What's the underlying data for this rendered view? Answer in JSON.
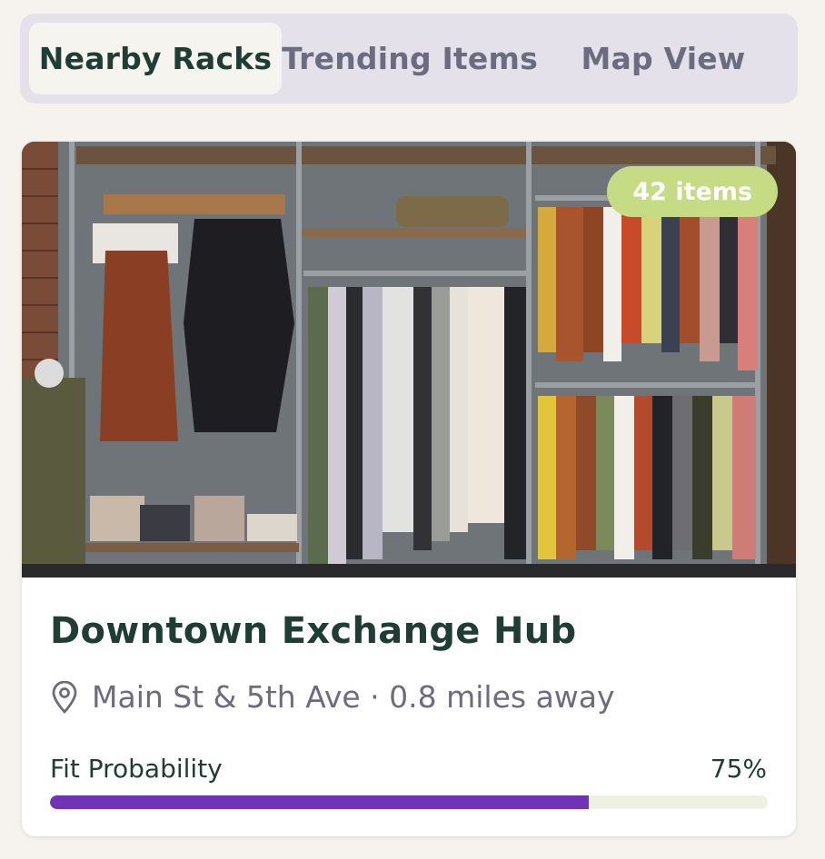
{
  "tabs": [
    {
      "label": "Nearby Racks",
      "active": true
    },
    {
      "label": "Trending Items",
      "active": false
    },
    {
      "label": "Map View",
      "active": false
    }
  ],
  "rack_card": {
    "image_alt": "Clothing racks with dresses and shirts on hangers",
    "badge": "42 items",
    "title": "Downtown Exchange Hub",
    "location_icon": "map-pin-icon",
    "location": "Main St & 5th Ave · 0.8 miles away",
    "fit_label": "Fit Probability",
    "fit_value": "75%",
    "fit_fraction": 0.75
  },
  "colors": {
    "brand_dark": "#1f3d35",
    "progress": "#6f33b8",
    "badge": "#c6dc84",
    "tab_bar": "#e4e1ea"
  }
}
